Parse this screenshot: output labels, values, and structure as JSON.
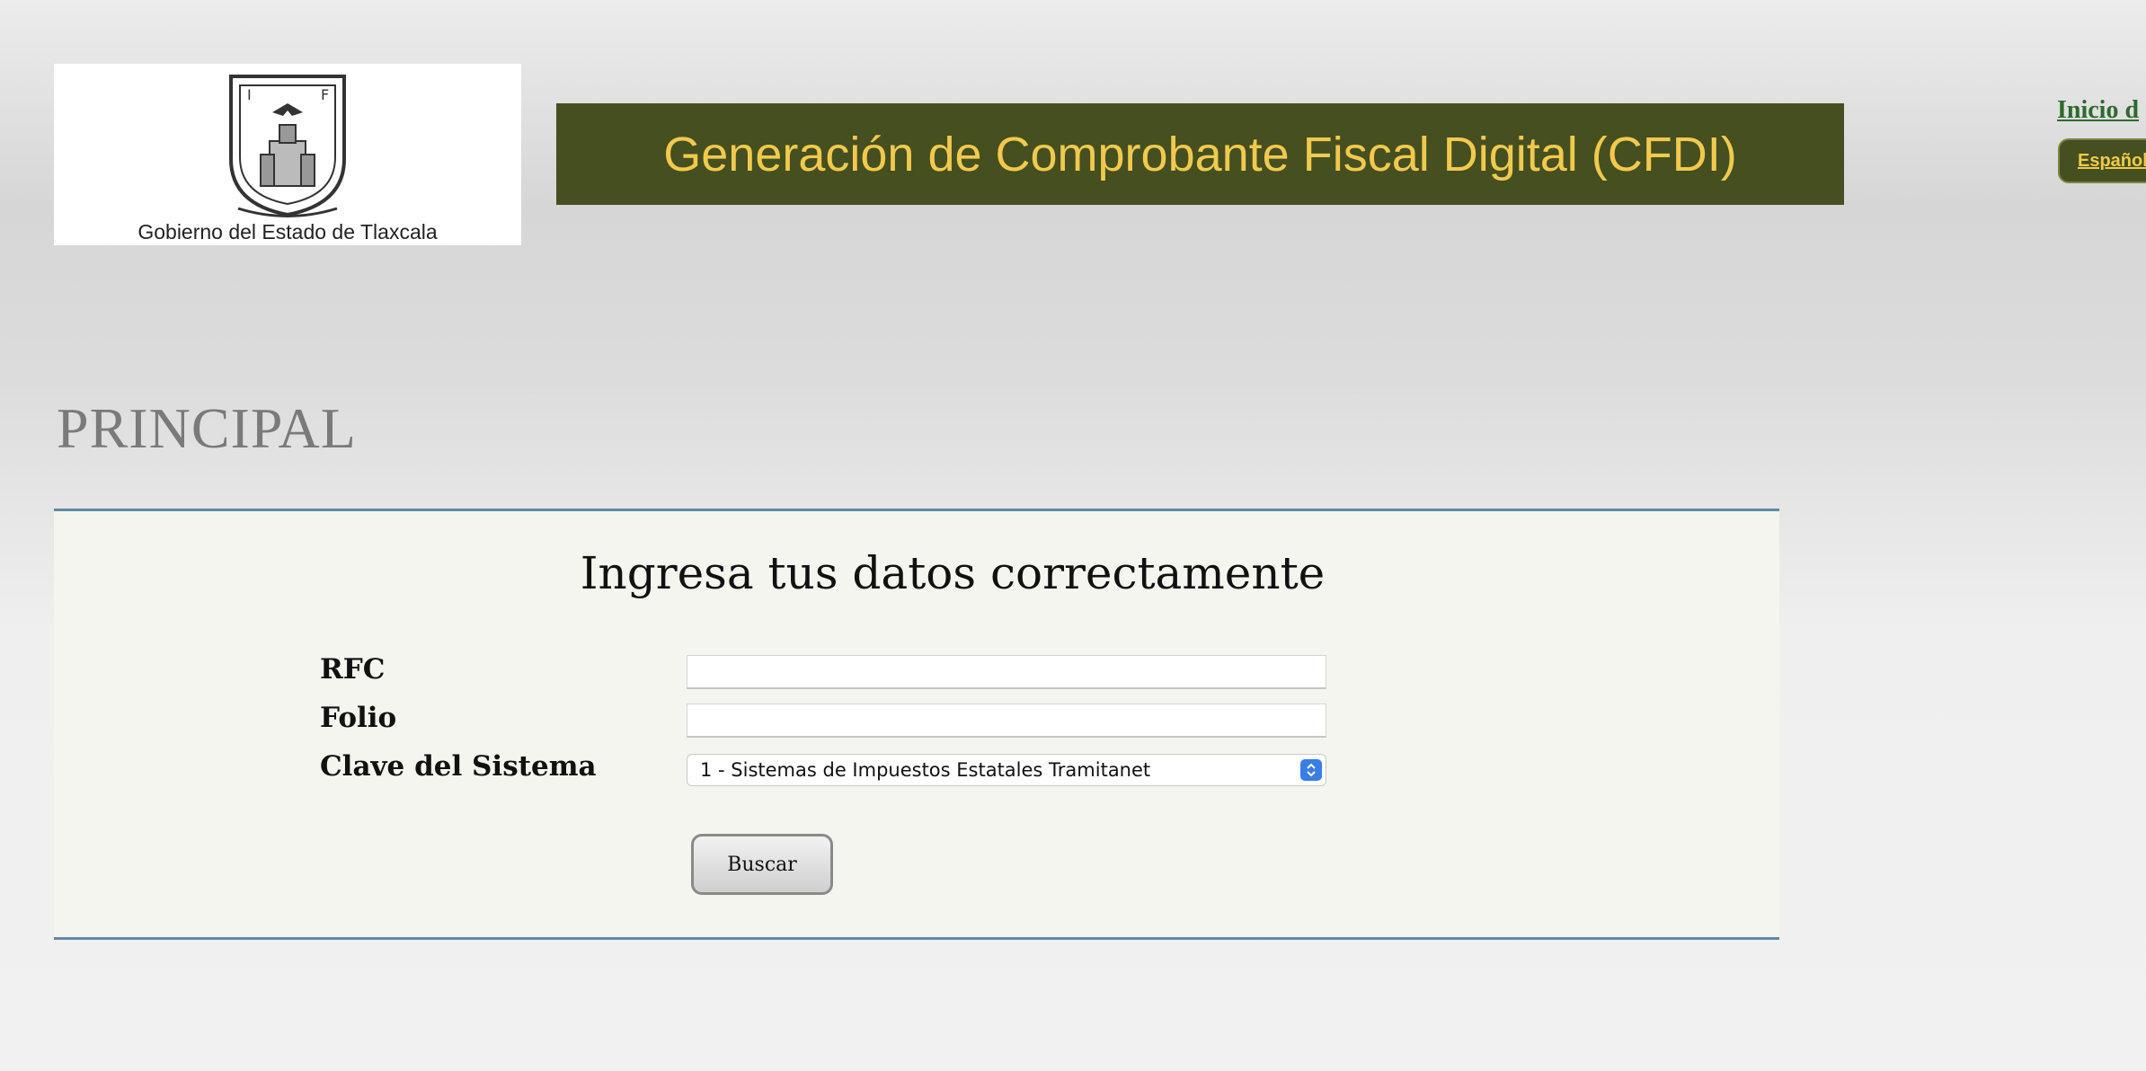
{
  "header": {
    "logo_caption": "Gobierno del Estado de Tlaxcala",
    "banner_title": "Generación de Comprobante Fiscal Digital (CFDI)",
    "top_link": "Inicio d",
    "language_button": "Español"
  },
  "main": {
    "page_heading": "PRINCIPAL",
    "form": {
      "title": "Ingresa tus datos correctamente",
      "rfc_label": "RFC",
      "rfc_value": "",
      "folio_label": "Folio",
      "folio_value": "",
      "clave_label": "Clave del Sistema",
      "clave_selected": "1 - Sistemas de Impuestos Estatales Tramitanet",
      "buscar_label": "Buscar"
    }
  },
  "colors": {
    "banner_bg": "#454f20",
    "banner_text": "#f2c94c",
    "link_green": "#2d6a2d",
    "panel_border": "#5f8aa3"
  }
}
